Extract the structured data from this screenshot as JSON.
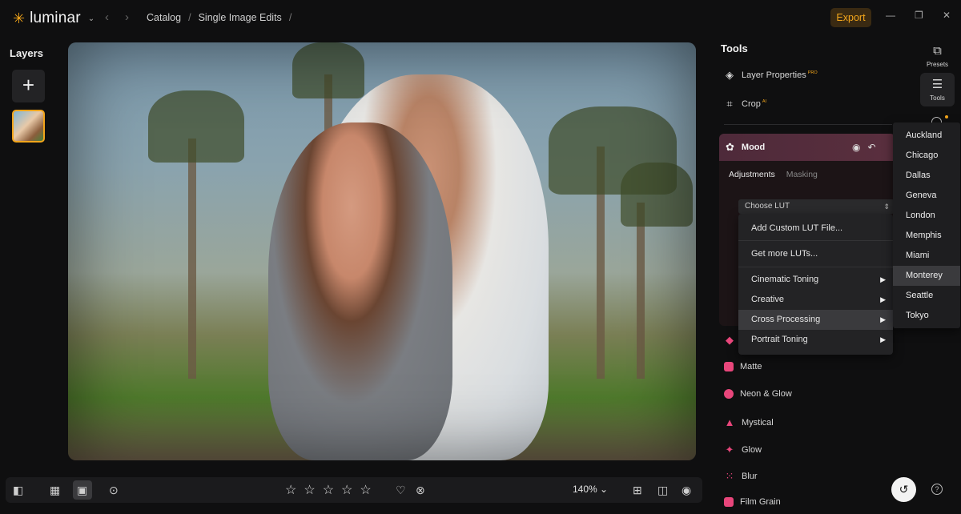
{
  "app": {
    "name": "luminar"
  },
  "breadcrumb": [
    "Catalog",
    "Single Image Edits"
  ],
  "toolbar": {
    "export_label": "Export"
  },
  "layers": {
    "title": "Layers"
  },
  "tools_panel": {
    "title": "Tools",
    "items": [
      {
        "label": "Layer Properties",
        "badge": "PRO",
        "icon": "layers-icon"
      },
      {
        "label": "Crop",
        "badge": "AI",
        "icon": "crop-icon"
      }
    ]
  },
  "right_rail": {
    "presets_label": "Presets",
    "tools_label": "Tools"
  },
  "mood": {
    "title": "Mood",
    "tabs": [
      "Adjustments",
      "Masking"
    ],
    "lut_placeholder": "Choose LUT"
  },
  "lut_menu": {
    "items": [
      {
        "label": "Add Custom LUT File..."
      },
      {
        "label": "Get more LUTs..."
      },
      {
        "label": "Cinematic Toning"
      },
      {
        "label": "Creative"
      },
      {
        "label": "Cross Processing"
      },
      {
        "label": "Portrait Toning"
      }
    ]
  },
  "city_menu": [
    "Auckland",
    "Chicago",
    "Dallas",
    "Geneva",
    "London",
    "Memphis",
    "Miami",
    "Monterey",
    "Seattle",
    "Tokyo"
  ],
  "creative_tools": [
    {
      "label": "Matte",
      "color": "#e8467b"
    },
    {
      "label": "Neon & Glow",
      "color": "#e8467b"
    },
    {
      "label": "Mystical",
      "color": "#e8467b"
    },
    {
      "label": "Glow",
      "color": "#e8467b"
    },
    {
      "label": "Blur",
      "color": "#e8467b"
    },
    {
      "label": "Film Grain",
      "color": "#e8467b"
    }
  ],
  "view": {
    "zoom": "140%"
  },
  "colors": {
    "accent": "#f2a51b",
    "background": "#0f0f10"
  }
}
